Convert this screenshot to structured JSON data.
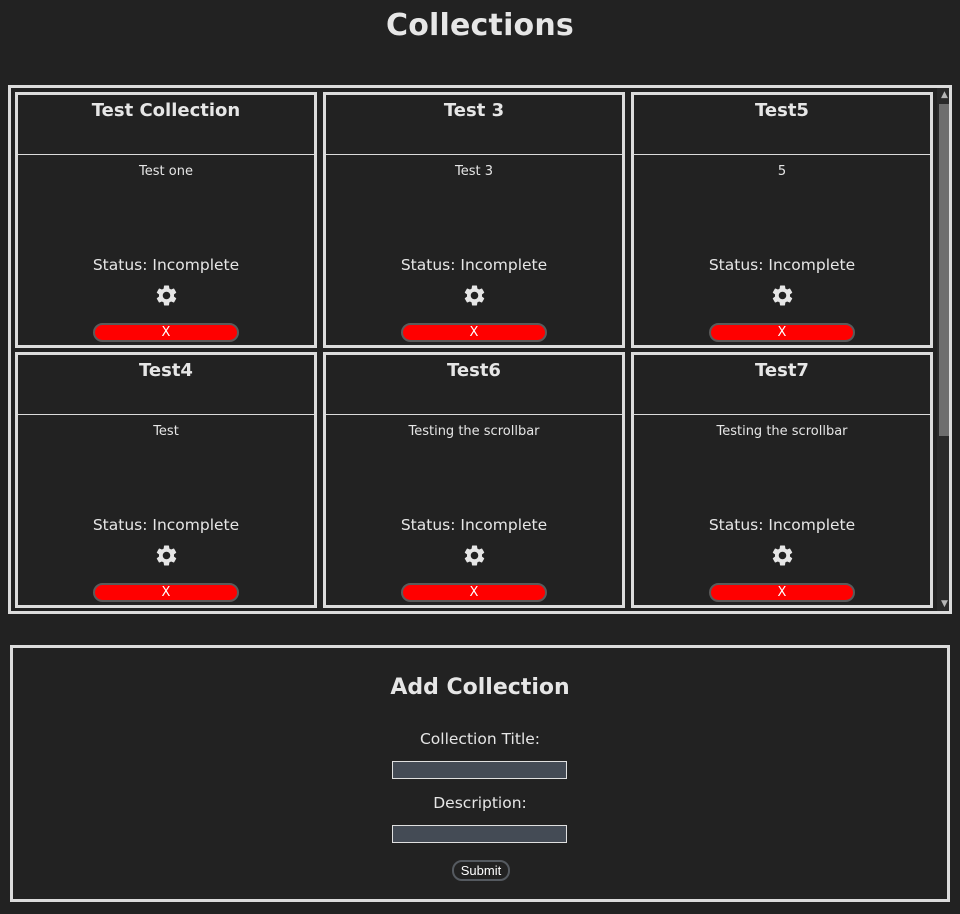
{
  "page": {
    "title": "Collections"
  },
  "collections": [
    {
      "title": "Test Collection",
      "description": "Test one",
      "status": "Status: Incomplete",
      "delete_label": "X"
    },
    {
      "title": "Test 3",
      "description": "Test 3",
      "status": "Status: Incomplete",
      "delete_label": "X"
    },
    {
      "title": "Test5",
      "description": "5",
      "status": "Status: Incomplete",
      "delete_label": "X"
    },
    {
      "title": "Test4",
      "description": "Test",
      "status": "Status: Incomplete",
      "delete_label": "X"
    },
    {
      "title": "Test6",
      "description": "Testing the scrollbar",
      "status": "Status: Incomplete",
      "delete_label": "X"
    },
    {
      "title": "Test7",
      "description": "Testing the scrollbar",
      "status": "Status: Incomplete",
      "delete_label": "X"
    }
  ],
  "card_icons": {
    "settings": "gear-icon"
  },
  "add_form": {
    "title": "Add Collection",
    "title_label": "Collection Title:",
    "title_value": "",
    "description_label": "Description:",
    "description_value": "",
    "submit_label": "Submit"
  },
  "colors": {
    "background": "#222222",
    "border": "#dcdcdc",
    "delete_button": "#ff0000",
    "input_background": "#444b55"
  }
}
